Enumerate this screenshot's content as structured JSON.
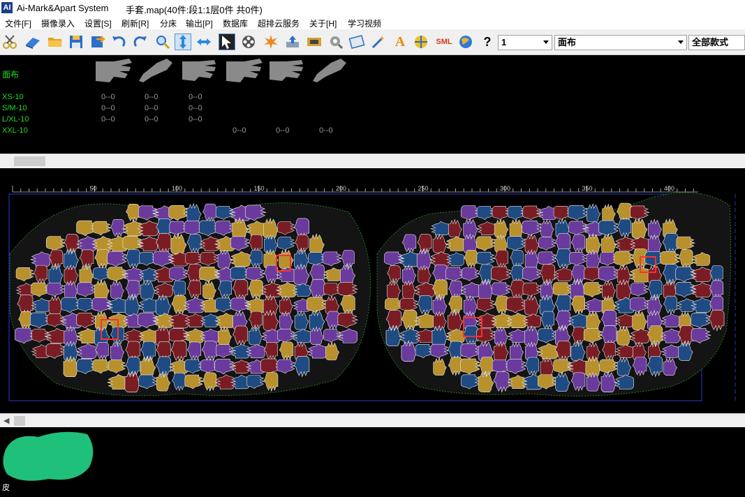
{
  "window": {
    "app_icon_text": "AI",
    "app_title": "Ai-Mark&Apart System",
    "document_title": "手套.map(40件:段1:1层0件 共0件)"
  },
  "menu": {
    "items": [
      "文件[F]",
      "摄像录入",
      "设置[S]",
      "刷新[R]",
      "分床",
      "输出[P]",
      "数据库",
      "超排云服务",
      "关于[H]",
      "学习视频"
    ]
  },
  "toolbar": {
    "icons": [
      "scissors-icon",
      "fabric-icon",
      "folder-open-icon",
      "save-icon",
      "import-icon",
      "undo-icon",
      "redo-icon",
      "zoom-icon",
      "vertical-flip-icon",
      "horizontal-flip-icon",
      "pointer-icon",
      "reel-icon",
      "burst-icon",
      "upload-icon",
      "film-icon",
      "tag-icon",
      "card-icon",
      "wand-icon",
      "text-a-icon",
      "ball-icon",
      "sml-icon",
      "globe-icon",
      "help-icon"
    ],
    "sml_text": "SML",
    "help_text": "?",
    "text_a": "A",
    "layer_combo_value": "1",
    "fabric_combo_value": "面布",
    "style_combo_value": "全部款式"
  },
  "parts": {
    "fabric_label": "面布",
    "sizes": [
      "XS-10",
      "S/M-10",
      "L/XL-10",
      "XXL-10"
    ],
    "counts": [
      [
        "0--0",
        "0--0",
        "0--0"
      ],
      [
        "0--0",
        "0--0",
        "0--0"
      ],
      [
        "0--0",
        "0--0",
        "0--0"
      ],
      [
        "0--0",
        "0--0",
        "0--0"
      ]
    ]
  },
  "ruler": {
    "labels": [
      "50",
      "100",
      "150",
      "200",
      "250",
      "300",
      "350",
      "400"
    ]
  },
  "colors": {
    "purple": "#6a3a9c",
    "yellow": "#b8902c",
    "blue": "#1f4a82",
    "maroon": "#7a1c24",
    "size_label_green": "#22dd22",
    "marker_border": "#2233aa"
  },
  "bottom": {
    "skin_label": "皮"
  }
}
